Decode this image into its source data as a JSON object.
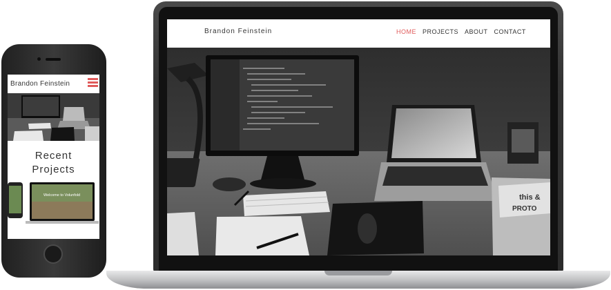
{
  "desktop": {
    "brand": "Brandon Feinstein",
    "nav": [
      {
        "label": "HOME",
        "active": true
      },
      {
        "label": "PROJECTS",
        "active": false
      },
      {
        "label": "ABOUT",
        "active": false
      },
      {
        "label": "CONTACT",
        "active": false
      }
    ]
  },
  "mobile": {
    "brand": "Brandon Feinstein",
    "section_title_line1": "Recent",
    "section_title_line2": "Projects",
    "project_tagline": "Welcome to Volunfold"
  },
  "colors": {
    "accent": "#e05a5a",
    "text": "#333333",
    "device_dark": "#2c2c2c",
    "device_silver": "#c8c9cb"
  }
}
